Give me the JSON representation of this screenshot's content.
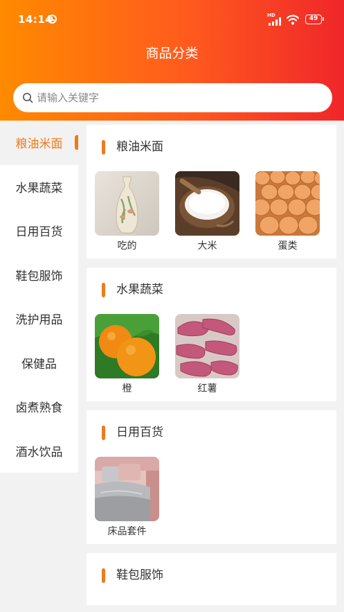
{
  "status": {
    "time": "14:14",
    "network": "HD",
    "battery": "49"
  },
  "header": {
    "title": "商品分类"
  },
  "search": {
    "placeholder": "请输入关键字"
  },
  "sidebar": {
    "items": [
      {
        "label": "粮油米面",
        "active": true
      },
      {
        "label": "水果蔬菜"
      },
      {
        "label": "日用百货"
      },
      {
        "label": "鞋包服饰"
      },
      {
        "label": "洗护用品"
      },
      {
        "label": "保健品"
      },
      {
        "label": "卤煮熟食"
      },
      {
        "label": "酒水饮品"
      }
    ]
  },
  "sections": [
    {
      "title": "粮油米面",
      "products": [
        {
          "name": "吃的",
          "icon": "vase-image"
        },
        {
          "name": "大米",
          "icon": "rice-image"
        },
        {
          "name": "蛋类",
          "icon": "eggs-image"
        }
      ]
    },
    {
      "title": "水果蔬菜",
      "products": [
        {
          "name": "橙",
          "icon": "oranges-image"
        },
        {
          "name": "红薯",
          "icon": "sweet-potato-image"
        }
      ]
    },
    {
      "title": "日用百货",
      "products": [
        {
          "name": "床品套件",
          "icon": "bedding-image"
        }
      ]
    },
    {
      "title": "鞋包服饰",
      "products": []
    }
  ],
  "colors": {
    "accent": "#f07a1a",
    "header_start": "#ff8a00",
    "header_end": "#f0262a"
  }
}
